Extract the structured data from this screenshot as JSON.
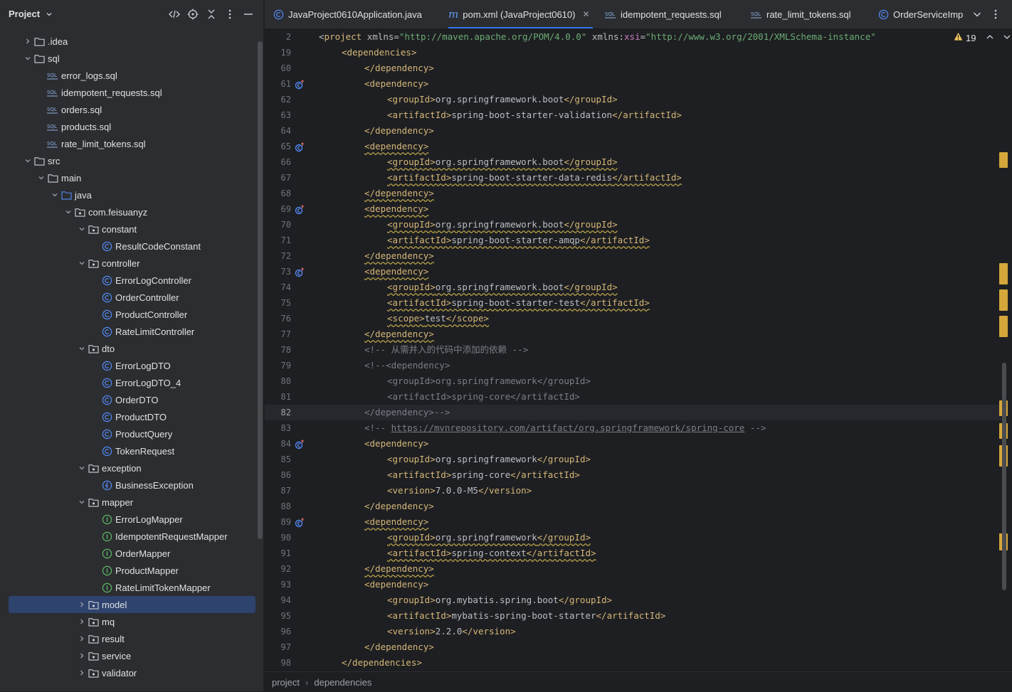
{
  "project_panel": {
    "title": "Project",
    "tree": [
      {
        "label": ".idea",
        "type": "folder",
        "depth": 1,
        "expanded": false
      },
      {
        "label": "sql",
        "type": "folder",
        "depth": 1,
        "expanded": true
      },
      {
        "label": "error_logs.sql",
        "type": "sql",
        "depth": 2
      },
      {
        "label": "idempotent_requests.sql",
        "type": "sql",
        "depth": 2
      },
      {
        "label": "orders.sql",
        "type": "sql",
        "depth": 2
      },
      {
        "label": "products.sql",
        "type": "sql",
        "depth": 2
      },
      {
        "label": "rate_limit_tokens.sql",
        "type": "sql",
        "depth": 2
      },
      {
        "label": "src",
        "type": "folder",
        "depth": 1,
        "expanded": true
      },
      {
        "label": "main",
        "type": "folder",
        "depth": 2,
        "expanded": true
      },
      {
        "label": "java",
        "type": "srcfolder",
        "depth": 3,
        "expanded": true
      },
      {
        "label": "com.feisuanyz",
        "type": "package",
        "depth": 4,
        "expanded": true
      },
      {
        "label": "constant",
        "type": "package",
        "depth": 5,
        "expanded": true
      },
      {
        "label": "ResultCodeConstant",
        "type": "class",
        "depth": 6
      },
      {
        "label": "controller",
        "type": "package",
        "depth": 5,
        "expanded": true
      },
      {
        "label": "ErrorLogController",
        "type": "class",
        "depth": 6
      },
      {
        "label": "OrderController",
        "type": "class",
        "depth": 6
      },
      {
        "label": "ProductController",
        "type": "class",
        "depth": 6
      },
      {
        "label": "RateLimitController",
        "type": "class",
        "depth": 6
      },
      {
        "label": "dto",
        "type": "package",
        "depth": 5,
        "expanded": true
      },
      {
        "label": "ErrorLogDTO",
        "type": "class",
        "depth": 6
      },
      {
        "label": "ErrorLogDTO_4",
        "type": "class",
        "depth": 6
      },
      {
        "label": "OrderDTO",
        "type": "class",
        "depth": 6
      },
      {
        "label": "ProductDTO",
        "type": "class",
        "depth": 6
      },
      {
        "label": "ProductQuery",
        "type": "class",
        "depth": 6
      },
      {
        "label": "TokenRequest",
        "type": "class",
        "depth": 6
      },
      {
        "label": "exception",
        "type": "package",
        "depth": 5,
        "expanded": true
      },
      {
        "label": "BusinessException",
        "type": "exception",
        "depth": 6
      },
      {
        "label": "mapper",
        "type": "package",
        "depth": 5,
        "expanded": true
      },
      {
        "label": "ErrorLogMapper",
        "type": "interface",
        "depth": 6
      },
      {
        "label": "IdempotentRequestMapper",
        "type": "interface",
        "depth": 6
      },
      {
        "label": "OrderMapper",
        "type": "interface",
        "depth": 6
      },
      {
        "label": "ProductMapper",
        "type": "interface",
        "depth": 6
      },
      {
        "label": "RateLimitTokenMapper",
        "type": "interface",
        "depth": 6
      },
      {
        "label": "model",
        "type": "package",
        "depth": 5,
        "expanded": false,
        "selected": true
      },
      {
        "label": "mq",
        "type": "package",
        "depth": 5,
        "expanded": false
      },
      {
        "label": "result",
        "type": "package",
        "depth": 5,
        "expanded": false
      },
      {
        "label": "service",
        "type": "package",
        "depth": 5,
        "expanded": false
      },
      {
        "label": "validator",
        "type": "package",
        "depth": 5,
        "expanded": false
      }
    ]
  },
  "tabs": [
    {
      "label": "JavaProject0610Application.java",
      "icon": "class-icon",
      "active": false
    },
    {
      "label": "pom.xml (JavaProject0610)",
      "icon": "maven-icon",
      "active": true,
      "closable": true
    },
    {
      "label": "idempotent_requests.sql",
      "icon": "sql-icon",
      "active": false
    },
    {
      "label": "rate_limit_tokens.sql",
      "icon": "sql-icon",
      "active": false
    },
    {
      "label": "OrderServiceImp",
      "icon": "class-icon",
      "active": false
    }
  ],
  "editor": {
    "warning_count": "19",
    "current_line": "82",
    "lines": [
      {
        "n": "2",
        "sticky": true,
        "indent": 0,
        "parts": [
          [
            "t",
            "<"
          ],
          [
            "tag",
            "project "
          ],
          [
            "attr",
            "xmlns"
          ],
          [
            "t",
            "="
          ],
          [
            "str",
            "\"http://maven.apache.org/POM/4.0.0\""
          ],
          [
            "t",
            " "
          ],
          [
            "attr",
            "xmlns"
          ],
          [
            "t",
            ":"
          ],
          [
            "ns",
            "xsi"
          ],
          [
            "t",
            "="
          ],
          [
            "str",
            "\"http://www.w3.org/2001/XMLSchema-instance\""
          ]
        ]
      },
      {
        "n": "19",
        "sticky": true,
        "indent": 1,
        "parts": [
          [
            "tag",
            "<dependencies>"
          ]
        ]
      },
      {
        "n": "60",
        "indent": 2,
        "parts": [
          [
            "tag",
            "</dependency>"
          ]
        ]
      },
      {
        "n": "61",
        "indent": 2,
        "gutter": true,
        "parts": [
          [
            "tag",
            "<dependency>"
          ]
        ]
      },
      {
        "n": "62",
        "indent": 3,
        "parts": [
          [
            "tag",
            "<groupId>"
          ],
          [
            "t",
            "org.springframework.boot"
          ],
          [
            "tag",
            "</groupId>"
          ]
        ]
      },
      {
        "n": "63",
        "indent": 3,
        "parts": [
          [
            "tag",
            "<artifactId>"
          ],
          [
            "t",
            "spring-boot-starter-validation"
          ],
          [
            "tag",
            "</artifactId>"
          ]
        ]
      },
      {
        "n": "64",
        "indent": 2,
        "parts": [
          [
            "tag",
            "</dependency>"
          ]
        ]
      },
      {
        "n": "65",
        "indent": 2,
        "gutter": true,
        "wavy": true,
        "parts": [
          [
            "tag",
            "<dependency>"
          ]
        ]
      },
      {
        "n": "66",
        "indent": 3,
        "wavy": true,
        "parts": [
          [
            "tag",
            "<groupId>"
          ],
          [
            "t",
            "org.springframework.boot"
          ],
          [
            "tag",
            "</groupId>"
          ]
        ]
      },
      {
        "n": "67",
        "indent": 3,
        "wavy": true,
        "parts": [
          [
            "tag",
            "<artifactId>"
          ],
          [
            "t",
            "spring-boot-starter-data-redis"
          ],
          [
            "tag",
            "</artifactId>"
          ]
        ]
      },
      {
        "n": "68",
        "indent": 2,
        "wavy": true,
        "parts": [
          [
            "tag",
            "</dependency>"
          ]
        ]
      },
      {
        "n": "69",
        "indent": 2,
        "gutter": true,
        "wavy": true,
        "parts": [
          [
            "tag",
            "<dependency>"
          ]
        ]
      },
      {
        "n": "70",
        "indent": 3,
        "wavy": true,
        "parts": [
          [
            "tag",
            "<groupId>"
          ],
          [
            "t",
            "org.springframework.boot"
          ],
          [
            "tag",
            "</groupId>"
          ]
        ]
      },
      {
        "n": "71",
        "indent": 3,
        "wavy": true,
        "parts": [
          [
            "tag",
            "<artifactId>"
          ],
          [
            "t",
            "spring-boot-starter-amqp"
          ],
          [
            "tag",
            "</artifactId>"
          ]
        ]
      },
      {
        "n": "72",
        "indent": 2,
        "wavy": true,
        "parts": [
          [
            "tag",
            "</dependency>"
          ]
        ]
      },
      {
        "n": "73",
        "indent": 2,
        "gutter": true,
        "wavy": true,
        "parts": [
          [
            "tag",
            "<dependency>"
          ]
        ]
      },
      {
        "n": "74",
        "indent": 3,
        "wavy": true,
        "parts": [
          [
            "tag",
            "<groupId>"
          ],
          [
            "t",
            "org.springframework.boot"
          ],
          [
            "tag",
            "</groupId>"
          ]
        ]
      },
      {
        "n": "75",
        "indent": 3,
        "wavy": true,
        "parts": [
          [
            "tag",
            "<artifactId>"
          ],
          [
            "t",
            "spring-boot-starter-test"
          ],
          [
            "tag",
            "</artifactId>"
          ]
        ]
      },
      {
        "n": "76",
        "indent": 3,
        "wavy": true,
        "parts": [
          [
            "tag",
            "<scope>"
          ],
          [
            "t",
            "test"
          ],
          [
            "tag",
            "</scope>"
          ]
        ]
      },
      {
        "n": "77",
        "indent": 2,
        "wavy": true,
        "parts": [
          [
            "tag",
            "</dependency>"
          ]
        ]
      },
      {
        "n": "78",
        "indent": 2,
        "parts": [
          [
            "cmt",
            "<!-- 从需并入的代码中添加的依赖 -->"
          ]
        ]
      },
      {
        "n": "79",
        "indent": 2,
        "parts": [
          [
            "cmt",
            "<!--<dependency>"
          ]
        ]
      },
      {
        "n": "80",
        "indent": 3,
        "parts": [
          [
            "cmt",
            "<groupId>org.springframework</groupId>"
          ]
        ]
      },
      {
        "n": "81",
        "indent": 3,
        "parts": [
          [
            "cmt",
            "<artifactId>spring-core</artifactId>"
          ]
        ]
      },
      {
        "n": "82",
        "indent": 2,
        "current": true,
        "parts": [
          [
            "cmt",
            "</dependency>-->"
          ]
        ]
      },
      {
        "n": "83",
        "indent": 2,
        "parts": [
          [
            "cmt",
            "<!-- "
          ],
          [
            "link",
            "https://mvnrepository.com/artifact/org.springframework/spring-core"
          ],
          [
            "cmt",
            " -->"
          ]
        ]
      },
      {
        "n": "84",
        "indent": 2,
        "gutter": true,
        "parts": [
          [
            "tag",
            "<dependency>"
          ]
        ]
      },
      {
        "n": "85",
        "indent": 3,
        "parts": [
          [
            "tag",
            "<groupId>"
          ],
          [
            "t",
            "org.springframework"
          ],
          [
            "tag",
            "</groupId>"
          ]
        ]
      },
      {
        "n": "86",
        "indent": 3,
        "parts": [
          [
            "tag",
            "<artifactId>"
          ],
          [
            "t",
            "spring-core"
          ],
          [
            "tag",
            "</artifactId>"
          ]
        ]
      },
      {
        "n": "87",
        "indent": 3,
        "parts": [
          [
            "tag",
            "<version>"
          ],
          [
            "t",
            "7.0.0-M5"
          ],
          [
            "tag",
            "</version>"
          ]
        ]
      },
      {
        "n": "88",
        "indent": 2,
        "parts": [
          [
            "tag",
            "</dependency>"
          ]
        ]
      },
      {
        "n": "89",
        "indent": 2,
        "gutter": true,
        "wavy": true,
        "parts": [
          [
            "tag",
            "<dependency>"
          ]
        ]
      },
      {
        "n": "90",
        "indent": 3,
        "wavy": true,
        "parts": [
          [
            "tag",
            "<groupId>"
          ],
          [
            "t",
            "org.springframework"
          ],
          [
            "tag",
            "</groupId>"
          ]
        ]
      },
      {
        "n": "91",
        "indent": 3,
        "wavy": true,
        "parts": [
          [
            "tag",
            "<artifactId>"
          ],
          [
            "t",
            "spring-context"
          ],
          [
            "tag",
            "</artifactId>"
          ]
        ]
      },
      {
        "n": "92",
        "indent": 2,
        "wavy": true,
        "parts": [
          [
            "tag",
            "</dependency>"
          ]
        ]
      },
      {
        "n": "93",
        "indent": 2,
        "parts": [
          [
            "tag",
            "<dependency>"
          ]
        ]
      },
      {
        "n": "94",
        "indent": 3,
        "parts": [
          [
            "tag",
            "<groupId>"
          ],
          [
            "t",
            "org.mybatis.spring.boot"
          ],
          [
            "tag",
            "</groupId>"
          ]
        ]
      },
      {
        "n": "95",
        "indent": 3,
        "parts": [
          [
            "tag",
            "<artifactId>"
          ],
          [
            "t",
            "mybatis-spring-boot-starter"
          ],
          [
            "tag",
            "</artifactId>"
          ]
        ]
      },
      {
        "n": "96",
        "indent": 3,
        "parts": [
          [
            "tag",
            "<version>"
          ],
          [
            "t",
            "2.2.0"
          ],
          [
            "tag",
            "</version>"
          ]
        ]
      },
      {
        "n": "97",
        "indent": 2,
        "parts": [
          [
            "tag",
            "</dependency>"
          ]
        ]
      },
      {
        "n": "98",
        "indent": 1,
        "parts": [
          [
            "tag",
            "</dependencies>"
          ]
        ]
      }
    ]
  },
  "breadcrumb": [
    "project",
    "dependencies"
  ],
  "colors": {
    "panel_bg": "#2b2d30",
    "editor_bg": "#1e1f22",
    "selection": "#2e436e",
    "accent": "#3574f0",
    "tag": "#d5b778",
    "string": "#6aab73",
    "comment": "#7a7e85",
    "warning": "#d5a63a"
  }
}
